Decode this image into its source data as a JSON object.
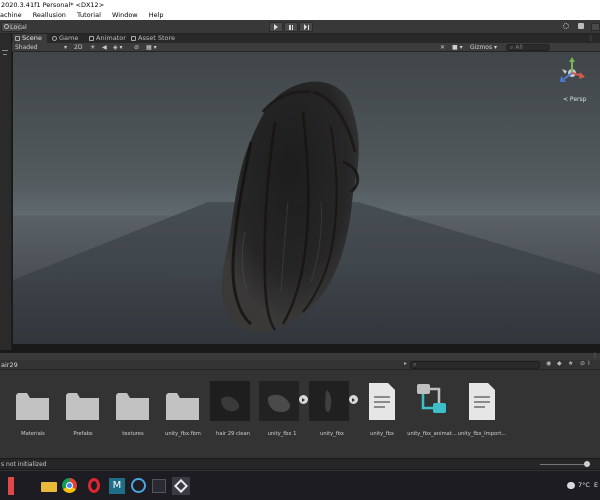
{
  "window": {
    "title": "2020.3.41f1 Personal* <DX12>"
  },
  "menu": {
    "items": [
      "achine",
      "Reallusion",
      "Tutorial",
      "Window",
      "Help"
    ]
  },
  "toolbar": {
    "local_label": "Local",
    "play_icon": "play-icon",
    "pause_icon": "pause-icon",
    "step_icon": "step-icon"
  },
  "tabs": [
    {
      "label": "Scene",
      "icon": "hash-icon",
      "active": true
    },
    {
      "label": "Game",
      "icon": "game-icon",
      "active": false
    },
    {
      "label": "Animator",
      "icon": "animator-icon",
      "active": false
    },
    {
      "label": "Asset Store",
      "icon": "store-icon",
      "active": false
    }
  ],
  "scene_controls": {
    "shading_mode": "Shaded",
    "mode_2d": "2D",
    "gizmos_label": "Gizmos",
    "search_placeholder": "All"
  },
  "gizmo": {
    "projection_label": "< Persp"
  },
  "project": {
    "breadcrumb": "air29",
    "search_placeholder": ""
  },
  "assets": [
    {
      "label": "Materials",
      "kind": "folder"
    },
    {
      "label": "Prefabs",
      "kind": "folder"
    },
    {
      "label": "textures",
      "kind": "folder"
    },
    {
      "label": "unity_fbx.fbm",
      "kind": "folder"
    },
    {
      "label": "hair 29 clean",
      "kind": "model"
    },
    {
      "label": "unity_fbx 1",
      "kind": "model"
    },
    {
      "label": "unity_fbx",
      "kind": "model"
    },
    {
      "label": "unity_fbx",
      "kind": "document"
    },
    {
      "label": "unity_fbx_animat...",
      "kind": "animator"
    },
    {
      "label": "unity_fbx_Import...",
      "kind": "document"
    }
  ],
  "status": {
    "message": "s not initialized"
  },
  "taskbar": {
    "temperature": "7°C",
    "language_abbrev": "E"
  },
  "colors": {
    "titlebar_bg": "#ffffff",
    "editor_bg": "#383838",
    "panel_bg": "#333333",
    "accent_teal": "#3cbfc6"
  }
}
